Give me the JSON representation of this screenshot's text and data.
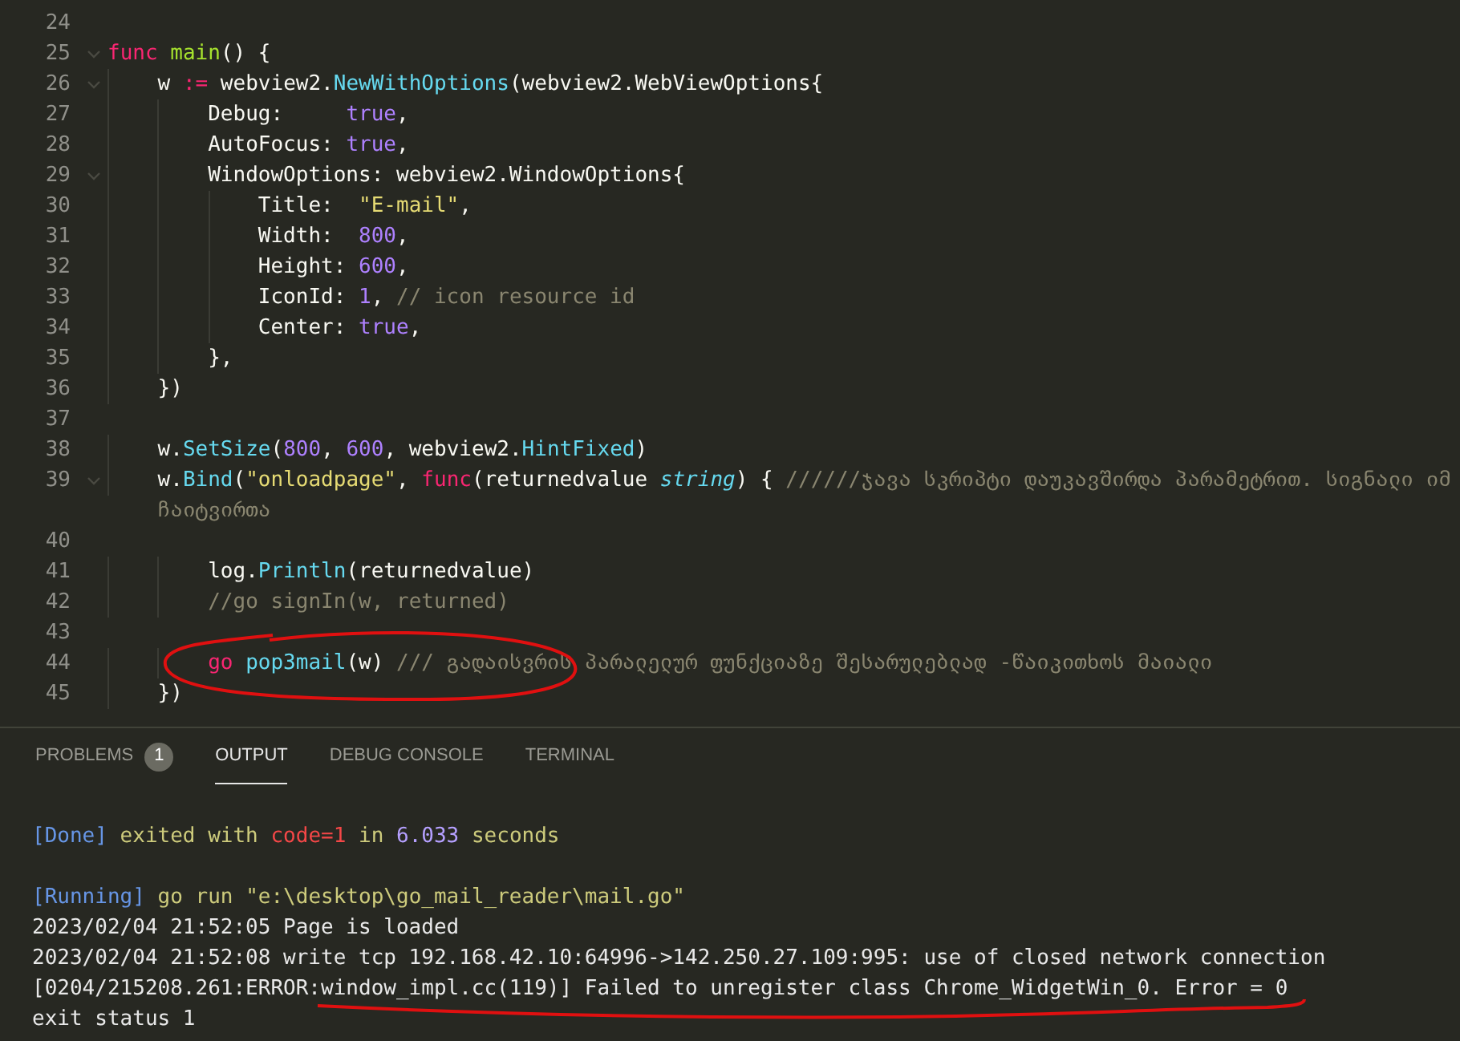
{
  "editor": {
    "lines": [
      {
        "number": "24",
        "foldable": false
      },
      {
        "number": "25",
        "foldable": true,
        "tokens": [
          {
            "text": "func",
            "kind": "keyword"
          },
          {
            "text": " main",
            "kind": "function"
          },
          {
            "text": "() {",
            "kind": "plain"
          }
        ]
      },
      {
        "number": "26",
        "foldable": true,
        "tokens": [
          {
            "text": "    w ",
            "kind": "plain"
          },
          {
            "text": ":=",
            "kind": "keyword"
          },
          {
            "text": " webview2.",
            "kind": "plain"
          },
          {
            "text": "NewWithOptions",
            "kind": "call"
          },
          {
            "text": "(webview2.WebViewOptions{",
            "kind": "plain"
          }
        ]
      },
      {
        "number": "27",
        "foldable": false,
        "tokens": [
          {
            "text": "        Debug:     ",
            "kind": "plain"
          },
          {
            "text": "true",
            "kind": "constant"
          },
          {
            "text": ",",
            "kind": "plain"
          }
        ]
      },
      {
        "number": "28",
        "foldable": false,
        "tokens": [
          {
            "text": "        AutoFocus: ",
            "kind": "plain"
          },
          {
            "text": "true",
            "kind": "constant"
          },
          {
            "text": ",",
            "kind": "plain"
          }
        ]
      },
      {
        "number": "29",
        "foldable": true,
        "tokens": [
          {
            "text": "        WindowOptions: webview2.WindowOptions{",
            "kind": "plain"
          }
        ]
      },
      {
        "number": "30",
        "foldable": false,
        "tokens": [
          {
            "text": "            Title:  ",
            "kind": "plain"
          },
          {
            "text": "\"E-mail\"",
            "kind": "string"
          },
          {
            "text": ",",
            "kind": "plain"
          }
        ]
      },
      {
        "number": "31",
        "foldable": false,
        "tokens": [
          {
            "text": "            Width:  ",
            "kind": "plain"
          },
          {
            "text": "800",
            "kind": "constant"
          },
          {
            "text": ",",
            "kind": "plain"
          }
        ]
      },
      {
        "number": "32",
        "foldable": false,
        "tokens": [
          {
            "text": "            Height: ",
            "kind": "plain"
          },
          {
            "text": "600",
            "kind": "constant"
          },
          {
            "text": ",",
            "kind": "plain"
          }
        ]
      },
      {
        "number": "33",
        "foldable": false,
        "tokens": [
          {
            "text": "            IconId: ",
            "kind": "plain"
          },
          {
            "text": "1",
            "kind": "constant"
          },
          {
            "text": ", ",
            "kind": "plain"
          },
          {
            "text": "// icon resource id",
            "kind": "comment"
          }
        ]
      },
      {
        "number": "34",
        "foldable": false,
        "tokens": [
          {
            "text": "            Center: ",
            "kind": "plain"
          },
          {
            "text": "true",
            "kind": "constant"
          },
          {
            "text": ",",
            "kind": "plain"
          }
        ]
      },
      {
        "number": "35",
        "foldable": false,
        "tokens": [
          {
            "text": "        },",
            "kind": "plain"
          }
        ]
      },
      {
        "number": "36",
        "foldable": false,
        "tokens": [
          {
            "text": "    })",
            "kind": "plain"
          }
        ]
      },
      {
        "number": "37",
        "foldable": false
      },
      {
        "number": "38",
        "foldable": false,
        "tokens": [
          {
            "text": "    w.",
            "kind": "plain"
          },
          {
            "text": "SetSize",
            "kind": "call"
          },
          {
            "text": "(",
            "kind": "plain"
          },
          {
            "text": "800",
            "kind": "constant"
          },
          {
            "text": ", ",
            "kind": "plain"
          },
          {
            "text": "600",
            "kind": "constant"
          },
          {
            "text": ", webview2.",
            "kind": "plain"
          },
          {
            "text": "HintFixed",
            "kind": "call"
          },
          {
            "text": ")",
            "kind": "plain"
          }
        ]
      },
      {
        "number": "39",
        "foldable": true,
        "tokens": [
          {
            "text": "    w.",
            "kind": "plain"
          },
          {
            "text": "Bind",
            "kind": "call"
          },
          {
            "text": "(",
            "kind": "plain"
          },
          {
            "text": "\"onloadpage\"",
            "kind": "string"
          },
          {
            "text": ", ",
            "kind": "plain"
          },
          {
            "text": "func",
            "kind": "keyword"
          },
          {
            "text": "(returnedvalue ",
            "kind": "plain"
          },
          {
            "text": "string",
            "kind": "type"
          },
          {
            "text": ") { ",
            "kind": "plain"
          },
          {
            "text": "//////ჯავა სკრიპტი დაუკავშირდა პარამეტრით. სიგნალი იმ",
            "kind": "comment"
          }
        ],
        "continuation": "ჩაიტვირთა"
      },
      {
        "number": "40",
        "foldable": false
      },
      {
        "number": "41",
        "foldable": false,
        "tokens": [
          {
            "text": "        log.",
            "kind": "plain"
          },
          {
            "text": "Println",
            "kind": "call"
          },
          {
            "text": "(returnedvalue)",
            "kind": "plain"
          }
        ]
      },
      {
        "number": "42",
        "foldable": false,
        "tokens": [
          {
            "text": "        //go signIn(w, returned)",
            "kind": "comment"
          }
        ]
      },
      {
        "number": "43",
        "foldable": false
      },
      {
        "number": "44",
        "foldable": false,
        "tokens": [
          {
            "text": "        go",
            "kind": "keyword"
          },
          {
            "text": " pop3mail",
            "kind": "call"
          },
          {
            "text": "(w) ",
            "kind": "plain"
          },
          {
            "text": "/// გადაისვრის პარალელურ ფუნქციაზე შესარულებლად -წაიკითხოს მაიალი",
            "kind": "comment"
          }
        ]
      },
      {
        "number": "45",
        "foldable": false,
        "tokens": [
          {
            "text": "    })",
            "kind": "plain"
          }
        ]
      }
    ]
  },
  "panel": {
    "tabs": [
      {
        "label": "PROBLEMS",
        "badge": "1",
        "selected": false
      },
      {
        "label": "OUTPUT",
        "selected": true
      },
      {
        "label": "DEBUG CONSOLE",
        "selected": false
      },
      {
        "label": "TERMINAL",
        "selected": false
      }
    ],
    "output": [
      {
        "kind": "blank"
      },
      {
        "kind": "text",
        "tokens": [
          {
            "text": "[Done]",
            "kind": "tag"
          },
          {
            "text": " exited with ",
            "kind": "info"
          },
          {
            "text": "code=1",
            "kind": "error"
          },
          {
            "text": " in ",
            "kind": "info"
          },
          {
            "text": "6.033",
            "kind": "number"
          },
          {
            "text": " seconds",
            "kind": "info"
          }
        ]
      },
      {
        "kind": "blank"
      },
      {
        "kind": "text",
        "tokens": [
          {
            "text": "[Running]",
            "kind": "tag"
          },
          {
            "text": " go run \"e:\\desktop\\go_mail_reader\\mail.go\"",
            "kind": "info"
          }
        ]
      },
      {
        "kind": "text",
        "tokens": [
          {
            "text": "2023/02/04 21:52:05 Page is loaded",
            "kind": "plain"
          }
        ]
      },
      {
        "kind": "text",
        "tokens": [
          {
            "text": "2023/02/04 21:52:08 write tcp 192.168.42.10:64996->142.250.27.109:995: use of closed network connection",
            "kind": "plain"
          }
        ]
      },
      {
        "kind": "text",
        "tokens": [
          {
            "text": "[0204/215208.261:ERROR:window_impl.cc(119)] Failed to unregister class Chrome_WidgetWin_0. Error = 0",
            "kind": "plain"
          }
        ]
      },
      {
        "kind": "text",
        "tokens": [
          {
            "text": "exit status 1",
            "kind": "plain"
          }
        ]
      }
    ]
  }
}
